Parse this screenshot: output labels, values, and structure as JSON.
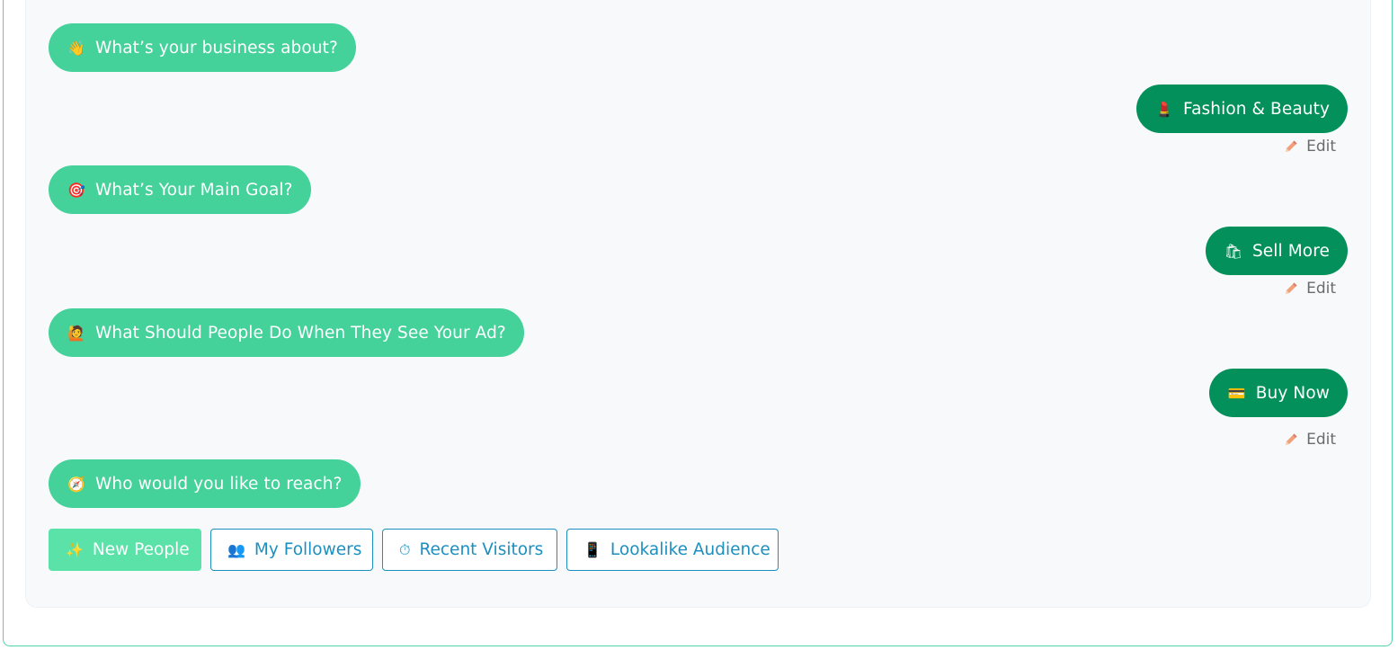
{
  "messages": [
    {
      "role": "bot",
      "icon": "waving-hand-icon",
      "glyph": "👋",
      "text": "What’s your business about?"
    },
    {
      "role": "user",
      "icon": "lipstick-icon",
      "glyph": "💄",
      "text": "Fashion & Beauty",
      "edit_label": "Edit"
    },
    {
      "role": "bot",
      "icon": "target-icon",
      "glyph": "🎯",
      "text": "What’s Your Main Goal?"
    },
    {
      "role": "user",
      "icon": "shopping-bags-icon",
      "glyph": "🛍",
      "text": "Sell More",
      "edit_label": "Edit"
    },
    {
      "role": "bot",
      "icon": "raised-hand-person-icon",
      "glyph": "🙋",
      "text": "What Should People Do When They See Your Ad?"
    },
    {
      "role": "user",
      "icon": "cash-register-icon",
      "glyph": "💳",
      "text": "Buy Now",
      "edit_label": "Edit"
    },
    {
      "role": "bot",
      "icon": "compass-icon",
      "glyph": "🧭",
      "text": "Who would you like to reach?"
    }
  ],
  "options": [
    {
      "icon": "sparkles-icon",
      "glyph": "✨",
      "label": "New People",
      "selected": true
    },
    {
      "icon": "people-icon",
      "glyph": "👥",
      "label": "My Followers",
      "selected": false
    },
    {
      "icon": "stopwatch-icon",
      "glyph": "⏱",
      "label": "Recent Visitors",
      "selected": false
    },
    {
      "icon": "mobile-phone-icon",
      "glyph": "📱",
      "label": "Lookalike Audience",
      "selected": false
    }
  ],
  "colors": {
    "bot_bubble": "#44d19a",
    "user_bubble": "#03905a",
    "option_border": "#1b8fbf",
    "option_selected": "#5ae2a8",
    "frame_border": "#52d3a3"
  }
}
